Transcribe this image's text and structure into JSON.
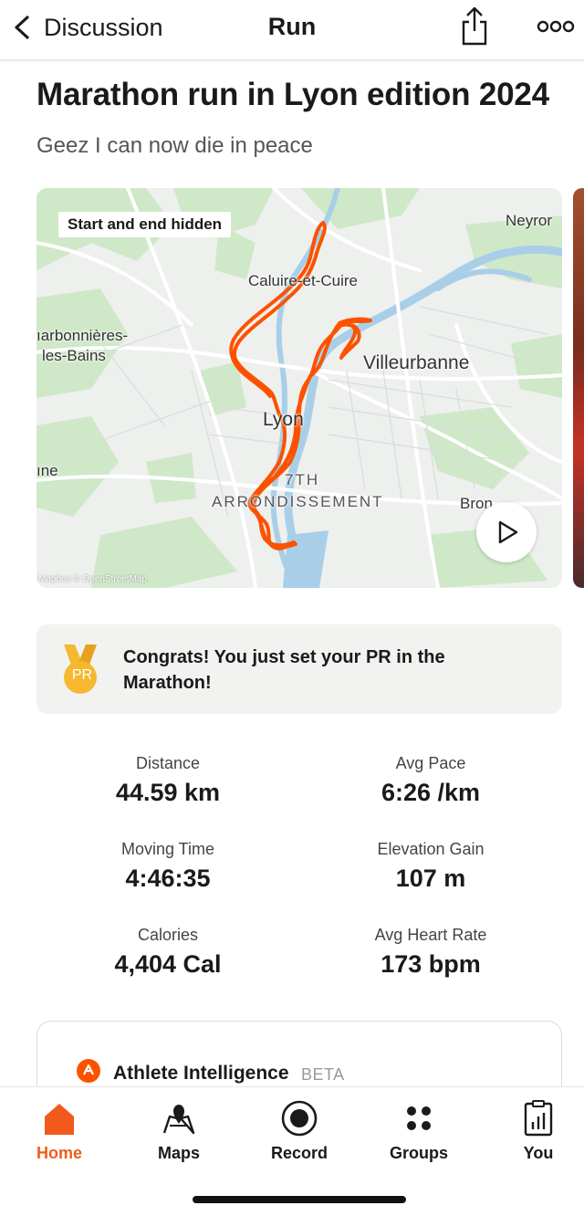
{
  "header": {
    "back_label": "Discussion",
    "title": "Run",
    "back_icon": "chevron-left-icon",
    "share_icon": "share-icon",
    "more_icon": "more-icon"
  },
  "activity": {
    "title": "Marathon run in Lyon edition 2024",
    "description": "Geez I can now die in peace"
  },
  "map": {
    "privacy_chip": "Start and end hidden",
    "labels": {
      "neyron": "Neyror",
      "caluire": "Caluire-et-Cuire",
      "charbonnieres_1": "ıarbonnières-",
      "charbonnieres_2": "les-Bains",
      "villeurbanne": "Villeurbanne",
      "lyon": "Lyon",
      "tassin": "ıne",
      "arrondissement_1": "7TH",
      "arrondissement_2": "ARRONDISSEMENT",
      "bron": "Bron"
    },
    "attribution": "Mapbox © OpenStreetMap",
    "route_color": "#fc5200",
    "play_icon": "play-icon"
  },
  "pr_card": {
    "medal_text": "PR",
    "text": "Congrats! You just set your PR in the Marathon!",
    "medal_color": "#f5b82e"
  },
  "stats": [
    {
      "label": "Distance",
      "value": "44.59 km"
    },
    {
      "label": "Avg Pace",
      "value": "6:26 /km"
    },
    {
      "label": "Moving Time",
      "value": "4:46:35"
    },
    {
      "label": "Elevation Gain",
      "value": "107 m"
    },
    {
      "label": "Calories",
      "value": "4,404 Cal"
    },
    {
      "label": "Avg Heart Rate",
      "value": "173 bpm"
    }
  ],
  "athlete_intelligence": {
    "title": "Athlete Intelligence",
    "badge": "BETA",
    "icon": "strava-logo-icon"
  },
  "nav": {
    "accent_color": "#f05a1c",
    "items": [
      {
        "label": "Home",
        "icon": "home-icon",
        "active": true
      },
      {
        "label": "Maps",
        "icon": "maps-icon",
        "active": false
      },
      {
        "label": "Record",
        "icon": "record-icon",
        "active": false
      },
      {
        "label": "Groups",
        "icon": "groups-icon",
        "active": false
      },
      {
        "label": "You",
        "icon": "you-icon",
        "active": false
      }
    ]
  }
}
